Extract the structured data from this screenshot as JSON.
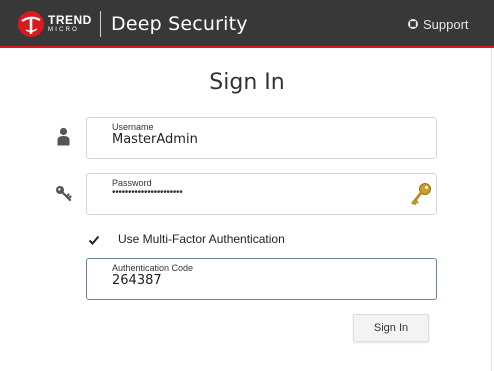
{
  "header": {
    "brand_line1": "TREND",
    "brand_line2": "MICRO",
    "product": "Deep Security",
    "support_label": "Support",
    "support_icon": "lifebuoy-icon",
    "accent_color": "#d71920",
    "bg_color": "#383838"
  },
  "form": {
    "title": "Sign In",
    "username": {
      "label": "Username",
      "value": "MasterAdmin",
      "icon": "user-icon"
    },
    "password": {
      "label": "Password",
      "value": "••••••••••••••••••••••",
      "icon": "key-icon",
      "trailing_icon": "golden-key-icon"
    },
    "mfa": {
      "label": "Use Multi-Factor Authentication",
      "checked": true
    },
    "auth_code": {
      "label": "Authentication Code",
      "value": "264387",
      "focus_color": "#6b7fa3"
    },
    "submit_label": "Sign In"
  }
}
